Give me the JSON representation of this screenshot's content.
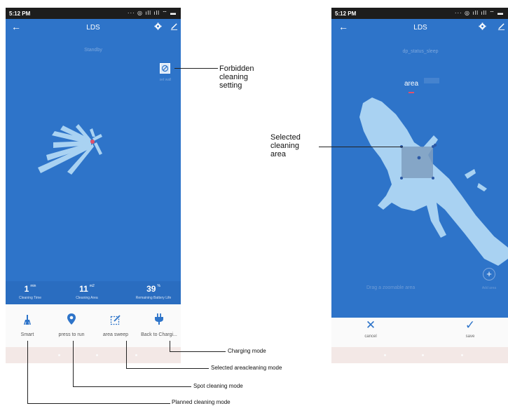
{
  "status_bar": {
    "time": "5:12 PM"
  },
  "left_screen": {
    "title": "LDS",
    "status": "Standby",
    "wall_label": "set wall",
    "stats": [
      {
        "value": "1",
        "unit": "min",
        "label": "Cleaning Time"
      },
      {
        "value": "11",
        "unit": "m2",
        "label": "Cleaning Area"
      },
      {
        "value": "39",
        "unit": "%",
        "label": "Remaining Battery Life"
      }
    ],
    "modes": [
      {
        "label": "Smart",
        "icon": "broom-icon"
      },
      {
        "label": "press to run",
        "icon": "location-pin-icon"
      },
      {
        "label": "area sweep",
        "icon": "area-select-icon"
      },
      {
        "label": "Back to Chargi...",
        "icon": "charging-plug-icon"
      }
    ]
  },
  "right_screen": {
    "title": "LDS",
    "status": "dp_status_sleep",
    "tab_area": "area",
    "drag_hint": "Drag a zoomable area",
    "add_area": "Add area",
    "cancel": "cancel",
    "save": "save"
  },
  "annotations": {
    "forbidden": [
      "Forbidden",
      "cleaning",
      "setting"
    ],
    "selected_area": [
      "Selected",
      "cleaning",
      "area"
    ],
    "charging_mode": "Charging mode",
    "selected_area_mode": "Selected areacleaning mode",
    "spot_mode": "Spot cleaning mode",
    "planned_mode": "Planned cleaning mode"
  },
  "colors": {
    "app_blue": "#2e74c9",
    "map_light": "#a9d2f2"
  }
}
